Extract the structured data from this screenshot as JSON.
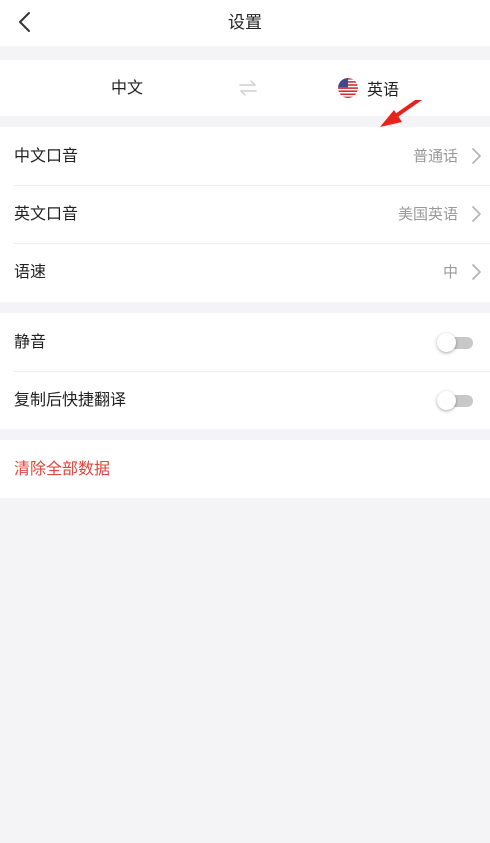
{
  "header": {
    "title": "设置",
    "back_icon": "chevron-left-icon"
  },
  "language_bar": {
    "source": "中文",
    "swap_icon": "swap-arrows-icon",
    "target": "英语",
    "target_flag_icon": "us-flag-icon"
  },
  "settings": {
    "chinese_accent": {
      "label": "中文口音",
      "value": "普通话"
    },
    "english_accent": {
      "label": "英文口音",
      "value": "美国英语"
    },
    "speech_rate": {
      "label": "语速",
      "value": "中"
    },
    "mute": {
      "label": "静音",
      "enabled": false
    },
    "copy_translate": {
      "label": "复制后快捷翻译",
      "enabled": false
    },
    "clear_data": {
      "label": "清除全部数据"
    }
  },
  "colors": {
    "accent_danger": "#e0453f",
    "annotation_arrow": "#e8231c",
    "background": "#f4f4f6"
  }
}
